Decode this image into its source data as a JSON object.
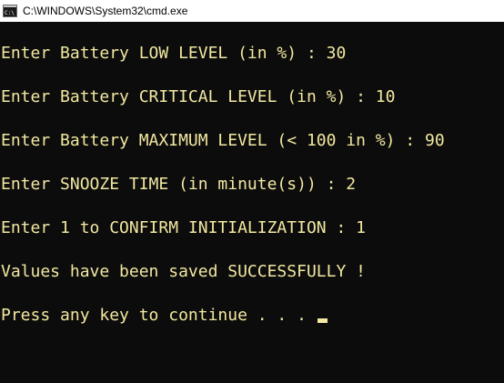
{
  "window": {
    "title": "C:\\WINDOWS\\System32\\cmd.exe",
    "icon": "cmd-console-icon"
  },
  "console": {
    "text_color": "#f2e8a0",
    "background_color": "#0c0c0c",
    "lines": [
      "Enter Battery LOW LEVEL (in %) : 30",
      "Enter Battery CRITICAL LEVEL (in %) : 10",
      "Enter Battery MAXIMUM LEVEL (< 100 in %) : 90",
      "Enter SNOOZE TIME (in minute(s)) : 2",
      "Enter 1 to CONFIRM INITIALIZATION : 1",
      "Values have been saved SUCCESSFULLY !",
      "Press any key to continue . . . "
    ]
  }
}
